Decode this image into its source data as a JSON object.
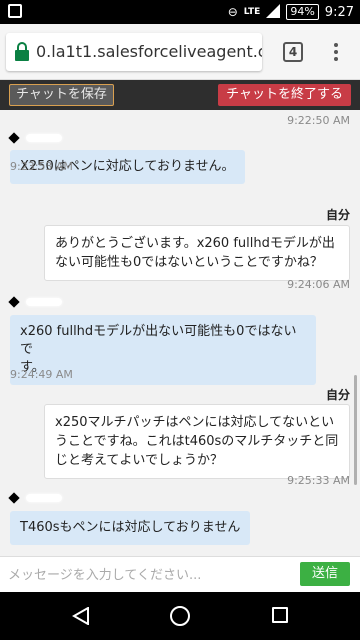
{
  "status_bar": {
    "network": "LTE",
    "battery": "94%",
    "time": "9:27"
  },
  "browser": {
    "url": "0.la1t1.salesforceliveagent.com/c",
    "tab_count": "4"
  },
  "toolbar": {
    "save_label": "チャットを保存",
    "end_label": "チャットを終了する",
    "save_border_color": "#d9a050",
    "end_color": "#c83c46"
  },
  "chat": {
    "self_name": "自分",
    "messages": [
      {
        "from": "user",
        "time": "9:22:50 AM"
      },
      {
        "from": "agent",
        "text": "X250はペンに対応しておりません。",
        "time": "9:23:53 AM"
      },
      {
        "from": "user",
        "text_lines": [
          "ありがとうございます。x260 fullhdモデルが出",
          "ない可能性も0ではないということですかね？"
        ],
        "time": "9:24:06 AM"
      },
      {
        "from": "agent",
        "text_lines": [
          "x260 fullhdモデルが出ない可能性も0ではないで",
          "す。"
        ],
        "time": "9:24:49 AM"
      },
      {
        "from": "user",
        "text_lines": [
          "x250マルチパッチはペンには対応してないとい",
          "うことですね。これはt460sのマルチタッチと同",
          "じと考えてよいでしょうか？"
        ],
        "time": "9:25:33 AM"
      },
      {
        "from": "agent",
        "text": "T460sもペンには対応しておりません"
      }
    ],
    "agent_bubble_color": "#d8e8f7"
  },
  "composer": {
    "placeholder": "メッセージを入力してください...",
    "send_label": "送信",
    "send_color": "#3cb043"
  }
}
